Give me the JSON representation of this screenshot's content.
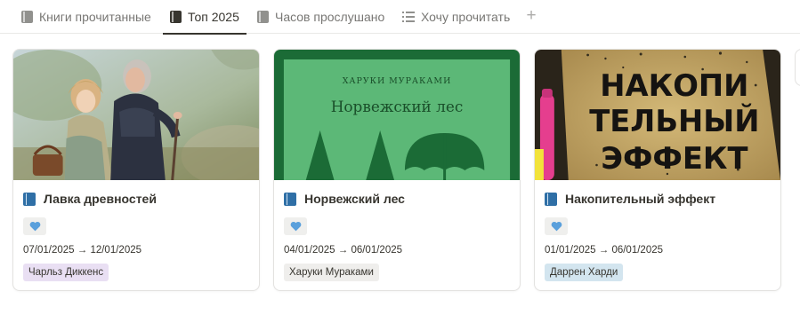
{
  "tabs": [
    {
      "label": "Книги прочитанные",
      "icon": "book-icon",
      "active": false
    },
    {
      "label": "Топ 2025",
      "icon": "book-icon",
      "active": true
    },
    {
      "label": "Часов прослушано",
      "icon": "book-icon",
      "active": false
    },
    {
      "label": "Хочу прочитать",
      "icon": "list-icon",
      "active": false
    }
  ],
  "add_tab_icon": "plus-icon",
  "cards": [
    {
      "title": "Лавка древностей",
      "title_icon": "book-icon",
      "tag_icon": "heart-icon",
      "date_range": "07/01/2025 → 12/01/2025",
      "author": "Чарльз Диккенс",
      "author_color": "#e9dff3"
    },
    {
      "title": "Норвежский лес",
      "title_icon": "book-icon",
      "tag_icon": "heart-icon",
      "date_range": "04/01/2025 → 06/01/2025",
      "author": "Харуки Мураками",
      "author_color": "#efeeec",
      "cover": {
        "author": "ХАРУКИ МУРАКАМИ",
        "title": "Норвежский лес"
      }
    },
    {
      "title": "Накопительный эффект",
      "title_icon": "book-icon",
      "tag_icon": "heart-icon",
      "date_range": "01/01/2025 → 06/01/2025",
      "author": "Даррен Харди",
      "author_color": "#d3e5ef",
      "cover": {
        "lines": [
          "НАКОПИ",
          "ТЕЛЬНЫЙ",
          "ЭФФЕКТ"
        ]
      }
    }
  ],
  "colors": {
    "heart": "#5aa0dc",
    "norwegian_green": "#5cb877",
    "norwegian_dark": "#1b6b36",
    "gold": "#c2a462"
  }
}
